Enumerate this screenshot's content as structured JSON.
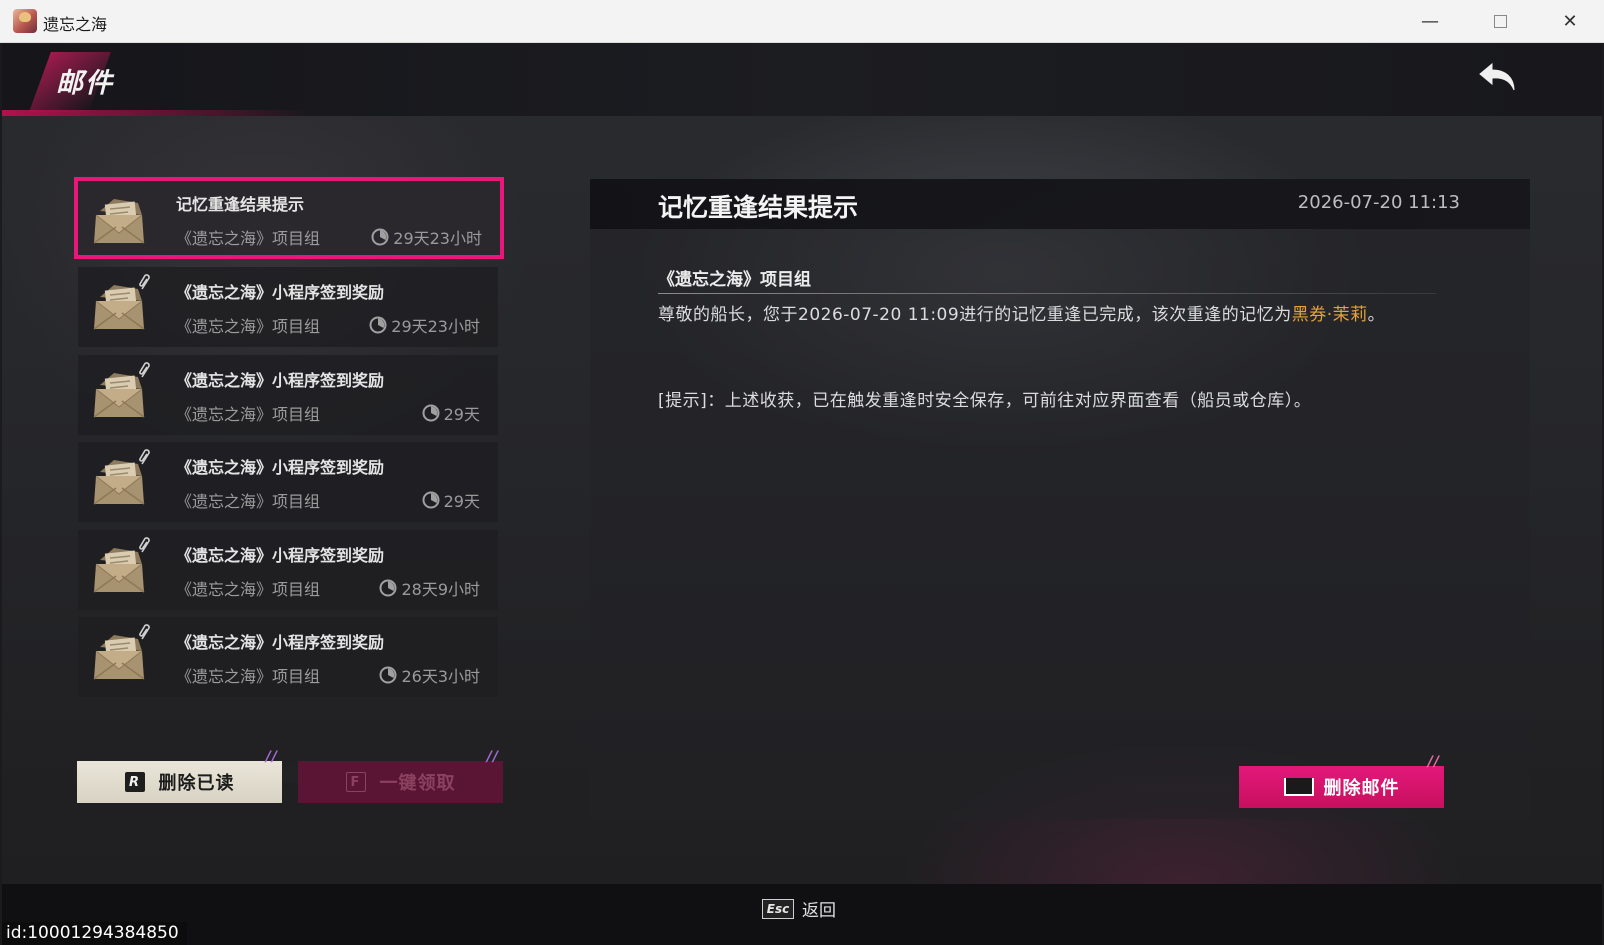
{
  "window": {
    "title": "遗忘之海",
    "icon": "app-icon",
    "controls": {
      "minimize": "—",
      "close": "✕"
    }
  },
  "header": {
    "title": "邮件",
    "back_icon": "back-arrow-icon"
  },
  "mail_list": [
    {
      "title": "记忆重逢结果提示",
      "sender": "《遗忘之海》项目组",
      "time_left": "29天23小时",
      "has_attachment": false,
      "selected": true
    },
    {
      "title": "《遗忘之海》小程序签到奖励",
      "sender": "《遗忘之海》项目组",
      "time_left": "29天23小时",
      "has_attachment": true,
      "selected": false
    },
    {
      "title": "《遗忘之海》小程序签到奖励",
      "sender": "《遗忘之海》项目组",
      "time_left": "29天",
      "has_attachment": true,
      "selected": false
    },
    {
      "title": "《遗忘之海》小程序签到奖励",
      "sender": "《遗忘之海》项目组",
      "time_left": "29天",
      "has_attachment": true,
      "selected": false
    },
    {
      "title": "《遗忘之海》小程序签到奖励",
      "sender": "《遗忘之海》项目组",
      "time_left": "28天9小时",
      "has_attachment": true,
      "selected": false
    },
    {
      "title": "《遗忘之海》小程序签到奖励",
      "sender": "《遗忘之海》项目组",
      "time_left": "26天3小时",
      "has_attachment": true,
      "selected": false
    }
  ],
  "list_buttons": {
    "delete_read": {
      "key": "R",
      "label": "删除已读"
    },
    "claim_all": {
      "key": "F",
      "label": "一键领取"
    }
  },
  "detail": {
    "title": "记忆重逢结果提示",
    "date": "2026-07-20 11:13",
    "sender": "《遗忘之海》项目组",
    "body_before": "尊敬的船长，您于2026-07-20 11:09进行的记忆重逢已完成，该次重逢的记忆为",
    "body_highlight": "黑券·茉莉",
    "body_after": "。",
    "hint": "[提示]：上述收获，已在触发重逢时安全保存，可前往对应界面查看（船员或仓库）。",
    "delete_button": "删除邮件"
  },
  "footer": {
    "esc_key": "Esc",
    "esc_label": "返回",
    "uid": "id:10001294384850"
  },
  "colors": {
    "accent": "#e8187a",
    "highlight": "#e8a23a"
  }
}
